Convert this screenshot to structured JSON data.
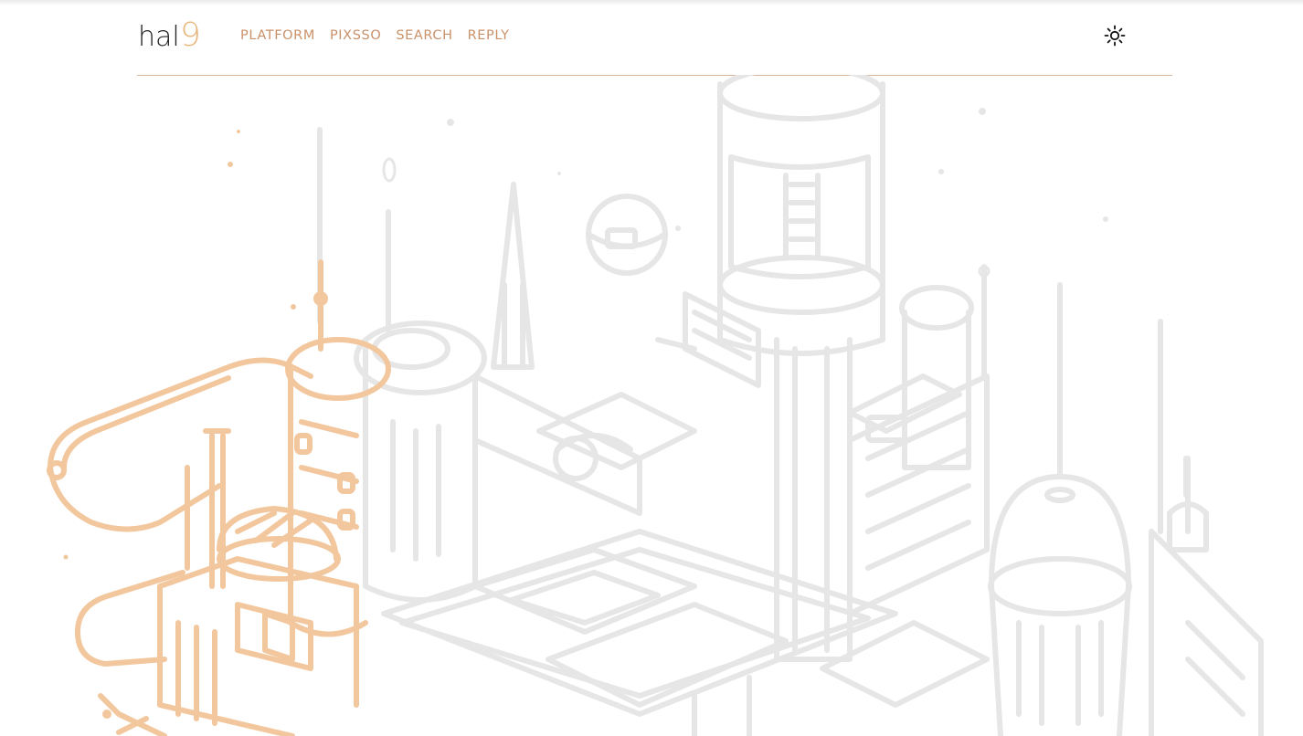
{
  "logo": {
    "text": "hal",
    "accent_text": "9",
    "accent_color": "#e8b77e"
  },
  "nav": {
    "items": [
      {
        "label": "PLATFORM"
      },
      {
        "label": "PIXSSO"
      },
      {
        "label": "SEARCH"
      },
      {
        "label": "REPLY"
      }
    ],
    "color": "#c9916a"
  },
  "theme_toggle": {
    "icon": "sun-icon"
  },
  "hero": {
    "description_icon": "isometric-city-illustration",
    "highlight_color": "#f3c79d",
    "base_color": "#e4e4e4"
  }
}
